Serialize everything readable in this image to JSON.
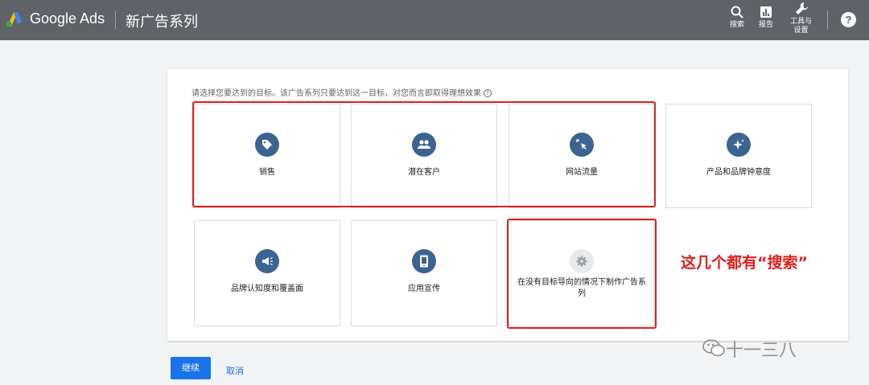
{
  "header": {
    "brand": "Google Ads",
    "campaign_title": "新广告系列",
    "search_label": "搜索",
    "reports_label": "报告",
    "tools_label_1": "工具与",
    "tools_label_2": "设置",
    "help_glyph": "?"
  },
  "main": {
    "instruction": "请选择您要达到的目标。该广告系列只要达到这一目标，对您而言即取得理想效果",
    "help_glyph": "?",
    "goals": [
      {
        "label": "销售",
        "icon": "tag-icon"
      },
      {
        "label": "潜在客户",
        "icon": "people-icon"
      },
      {
        "label": "网站流量",
        "icon": "cursor-click-icon"
      },
      {
        "label": "产品和品牌钟意度",
        "icon": "sparkle-icon"
      },
      {
        "label": "品牌认知度和覆盖面",
        "icon": "megaphone-icon"
      },
      {
        "label": "应用宣传",
        "icon": "phone-icon"
      },
      {
        "label": "在没有目标导向的情况下制作广告系列",
        "icon": "gear-icon"
      }
    ],
    "annotation": "这几个都有“搜索”"
  },
  "actions": {
    "continue_label": "继续",
    "cancel_label": "取消"
  },
  "watermark": "十一三八",
  "colors": {
    "topbar": "#5f6368",
    "icon_circle": "#3c6491",
    "highlight": "#e02020",
    "primary": "#1a73e8"
  }
}
